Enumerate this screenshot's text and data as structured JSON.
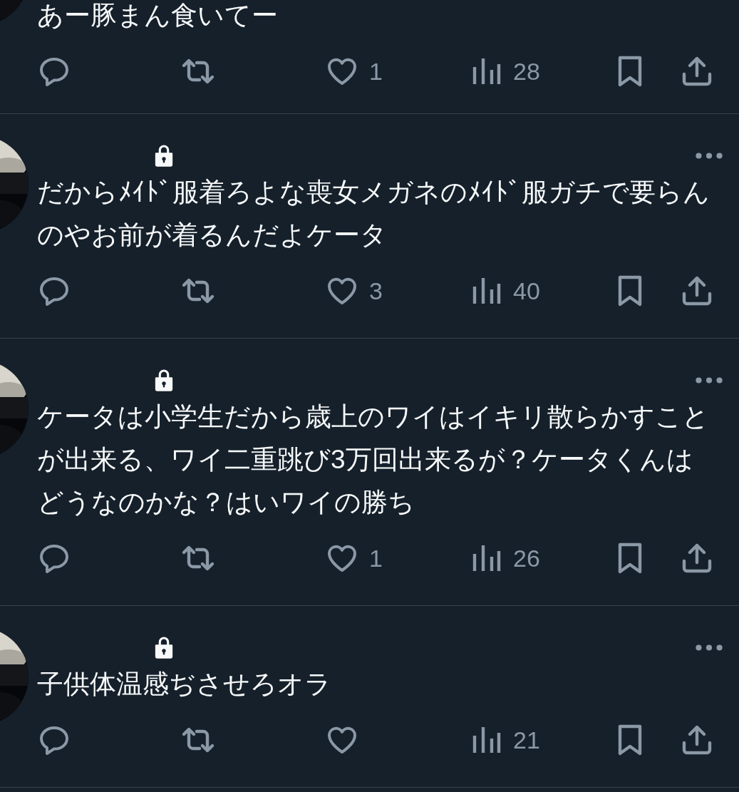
{
  "tweets": [
    {
      "text": "あー豚まん食いてー",
      "actions": {
        "likes": "1",
        "views": "28"
      }
    },
    {
      "protected": true,
      "text": "だからﾒｲﾄﾞ服着ろよな喪女メガネのﾒｲﾄﾞ服ガチで要らんのやお前が着るんだよケータ",
      "actions": {
        "likes": "3",
        "views": "40"
      }
    },
    {
      "protected": true,
      "text": "ケータは小学生だから歳上のワイはイキリ散らかすことが出来る、ワイ二重跳び3万回出来るが？ケータくんはどうなのかな？はいワイの勝ち",
      "actions": {
        "likes": "1",
        "views": "26"
      }
    },
    {
      "protected": true,
      "text": "子供体温感ぢさせろオラ",
      "actions": {
        "views": "21"
      }
    }
  ]
}
